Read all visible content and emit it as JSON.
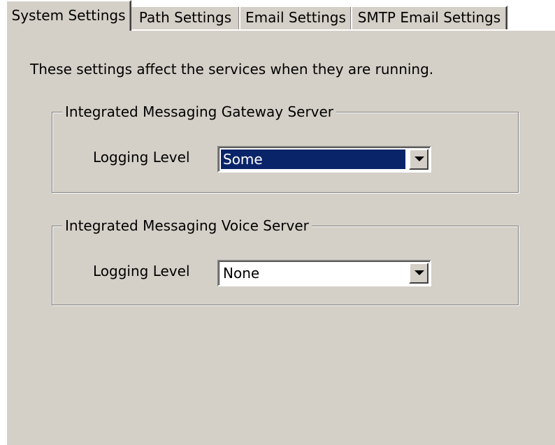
{
  "tabs": [
    {
      "label": "System Settings",
      "active": true
    },
    {
      "label": "Path Settings",
      "active": false
    },
    {
      "label": "Email Settings",
      "active": false
    },
    {
      "label": "SMTP Email Settings",
      "active": false
    }
  ],
  "panel": {
    "intro": "These settings affect the services when they are running.",
    "groups": [
      {
        "title": "Integrated Messaging Gateway Server",
        "field_label": "Logging Level",
        "value": "Some",
        "selected": true
      },
      {
        "title": "Integrated Messaging Voice Server",
        "field_label": "Logging Level",
        "value": "None",
        "selected": false
      }
    ]
  },
  "colors": {
    "face": "#d4d0c8",
    "highlight": "#0a246a",
    "window": "#ffffff"
  },
  "icons": {
    "dropdown": "chevron-down-icon"
  }
}
